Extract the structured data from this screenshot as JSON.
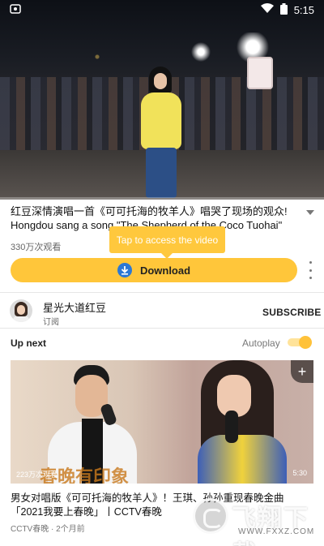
{
  "status_bar": {
    "time": "5:15",
    "icons": [
      "app-notification-icon",
      "wifi-icon",
      "battery-icon"
    ]
  },
  "player": {
    "progress_fraction": 0.0
  },
  "video": {
    "title_zh": "红豆深情演唱一首《可可托海的牧羊人》唱哭了现场的观众!",
    "title_en": "Hongdou sang a song \"The Shepherd of the Coco Tuohai\"",
    "views": "330万次观看"
  },
  "tooltip": {
    "text": "Tap to access the video"
  },
  "download": {
    "label": "Download",
    "icon": "download-arrow-icon"
  },
  "channel": {
    "name": "星光大道红豆",
    "subtitle": "订阅",
    "subscribe_label": "SUBSCRIBE"
  },
  "up_next": {
    "heading": "Up next",
    "autoplay_label": "Autoplay",
    "autoplay_on": true
  },
  "next_video": {
    "thumbnail_caption": "春晚有印象",
    "views": "223万次观看",
    "duration": "5:30",
    "title": "男女对唱版《可可托海的牧羊人》！王琪、孙孙重现春晚金曲「2021我要上春晚」丨CCTV春晚",
    "meta": "CCTV春晚 · 2个月前"
  },
  "watermark": {
    "text": "飞翔下载",
    "url": "WWW.FXXZ.COM"
  },
  "colors": {
    "accent": "#ffc63a",
    "download_icon": "#2b78d6"
  }
}
